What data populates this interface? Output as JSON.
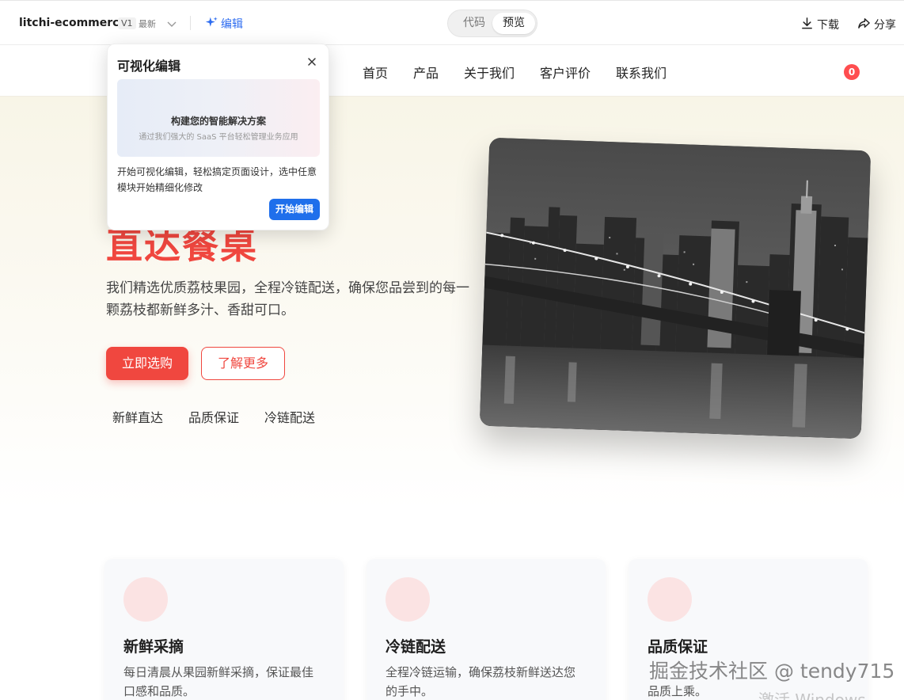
{
  "editor": {
    "project_name": "litchi-ecommerc...",
    "version": "V1",
    "version_tag": "最新",
    "edit_label": "编辑",
    "mode_code": "代码",
    "mode_preview": "预览",
    "download_label": "下载",
    "share_label": "分享",
    "accent_color": "#2d6cf0"
  },
  "nav": {
    "items": [
      "首页",
      "产品",
      "关于我们",
      "客户评价",
      "联系我们"
    ],
    "cart_count": "0"
  },
  "hero": {
    "title": "直达餐桌",
    "description": "我们精选优质荔枝果园，全程冷链配送，确保您品尝到的每一颗荔枝都新鲜多汁、香甜可口。",
    "primary_button": "立即选购",
    "secondary_button": "了解更多",
    "features": [
      "新鲜直达",
      "品质保证",
      "冷链配送"
    ],
    "brand_color": "#f0473f"
  },
  "cards": [
    {
      "title": "新鲜采摘",
      "description": "每日清晨从果园新鲜采摘，保证最佳口感和品质。"
    },
    {
      "title": "冷链配送",
      "description": "全程冷链运输，确保荔枝新鲜送达您的手中。"
    },
    {
      "title": "品质保证",
      "description": "品质上乘。"
    }
  ],
  "popover": {
    "title": "可视化编辑",
    "preview_title": "构建您的智能解决方案",
    "preview_subtitle": "通过我们强大的 SaaS 平台轻松管理业务应用",
    "text": "开始可视化编辑，轻松搞定页面设计，选中任意模块开始精细化修改",
    "start_button": "开始编辑",
    "button_color": "#1f6feb"
  },
  "watermark": {
    "juejin": "掘金技术社区 @ tendy715",
    "windows": "激活 Windows"
  }
}
